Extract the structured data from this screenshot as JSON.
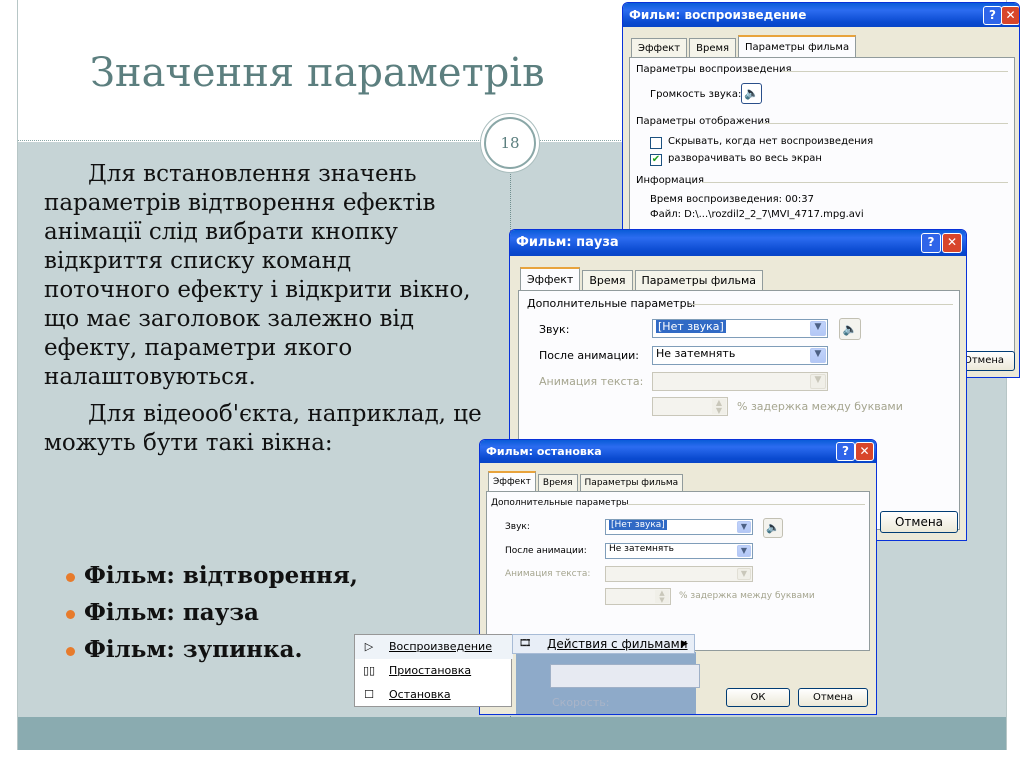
{
  "slide": {
    "title": "Значення параметрів",
    "number": "18",
    "paragraph1": "Для встановлення значень параметрів відтворення ефектів анімації слід вибрати кнопку відкриття списку команд поточного ефекту і відкрити вікно, що має заголовок залежно від ефекту, параметри якого налаштовуються.",
    "paragraph2": "Для відеооб'єкта, наприклад, це можуть бути такі вікна:",
    "bullets": [
      "Фільм: відтворення,",
      "Фільм: пауза",
      "Фільм: зупинка."
    ],
    "colors": {
      "title": "#5c7f7f",
      "content_bg": "#c6d4d6",
      "footer": "#8aabb0",
      "bullet": "#e77b2c"
    }
  },
  "dialog_play": {
    "title": "Фильм: воспроизведение",
    "tabs": [
      "Эффект",
      "Время",
      "Параметры фильма"
    ],
    "group_playback": "Параметры воспроизведения",
    "volume_label": "Громкость звука:",
    "group_display": "Параметры отображения",
    "hide_label": "Скрывать, когда нет воспроизведения",
    "fullscreen_label": "разворачивать во весь экран",
    "hide_checked": false,
    "fullscreen_checked": true,
    "group_info": "Информация",
    "playtime": "Время воспроизведения:  00:37",
    "file": "Файл:  D:\\...\\rozdil2_2_7\\MVI_4717.mpg.avi",
    "cancel_label": "Отмена"
  },
  "dialog_pause": {
    "title": "Фильм: пауза",
    "tabs": [
      "Эффект",
      "Время",
      "Параметры фильма"
    ],
    "group": "Дополнительные параметры",
    "sound_label": "Звук:",
    "sound_value": "[Нет звука]",
    "after_label": "После анимации:",
    "after_value": "Не затемнять",
    "text_anim_label": "Анимация текста:",
    "delay_label": "% задержка между буквами"
  },
  "dialog_stop": {
    "title": "Фильм: остановка",
    "tabs": [
      "Эффект",
      "Время",
      "Параметры фильма"
    ],
    "group": "Дополнительные параметры",
    "sound_label": "Звук:",
    "sound_value": "[Нет звука]",
    "after_label": "После анимации:",
    "after_value": "Не затемнять",
    "text_anim_label": "Анимация текста:",
    "delay_label": "% задержка между буквами",
    "ok_label": "ОК",
    "cancel_label": "Отмена",
    "cancel2_label": "Отмена",
    "speed_label": "Скорость:"
  },
  "context_menu": {
    "items": [
      {
        "label": "Воспроизведение",
        "icon": "play-icon"
      },
      {
        "label": "Приостановка",
        "icon": "pause-icon"
      },
      {
        "label": "Остановка",
        "icon": "stop-icon"
      }
    ],
    "submenu_label": "Действия с фильмами"
  }
}
